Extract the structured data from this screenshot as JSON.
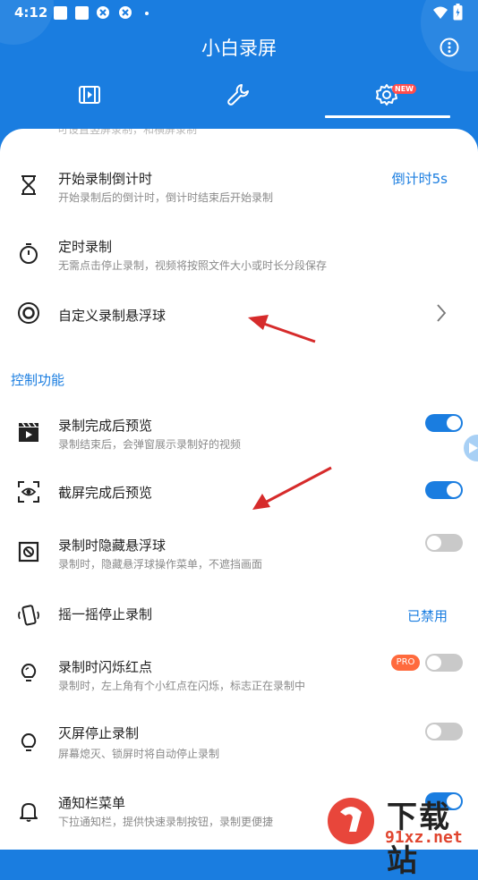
{
  "status_bar": {
    "time": "4:12"
  },
  "app_bar": {
    "title": "小白录屏"
  },
  "tabs": [
    {
      "icon": "video-list-icon",
      "selected": false
    },
    {
      "icon": "wrench-icon",
      "selected": false
    },
    {
      "icon": "settings-gear-icon",
      "selected": true,
      "badge": "NEW"
    }
  ],
  "faded_text": "可设置竖屏录制，和横屏录制",
  "items": [
    {
      "title": "开始录制倒计时",
      "subtitle": "开始录制后的倒计时，倒计时结束后开始录制",
      "value": "倒计时5s",
      "icon": "hourglass-icon"
    },
    {
      "title": "定时录制",
      "subtitle": "无需点击停止录制，视频将按照文件大小或时长分段保存",
      "icon": "stopwatch-icon"
    },
    {
      "title": "自定义录制悬浮球",
      "icon": "target-ring-icon"
    }
  ],
  "section": {
    "title": "控制功能"
  },
  "controls": [
    {
      "title": "录制完成后预览",
      "subtitle": "录制结束后，会弹窗展示录制好的视频",
      "toggle": true,
      "icon": "clapperboard-icon"
    },
    {
      "title": "截屏完成后预览",
      "toggle": true,
      "icon": "screenshot-eye-icon"
    },
    {
      "title": "录制时隐藏悬浮球",
      "subtitle": "录制时，隐藏悬浮球操作菜单，不遮挡画面",
      "toggle": false,
      "icon": "hide-ball-icon"
    },
    {
      "title": "摇一摇停止录制",
      "value": "已禁用",
      "icon": "shake-phone-icon"
    },
    {
      "title": "录制时闪烁红点",
      "subtitle": "录制时，左上角有个小红点在闪烁，标志正在录制中",
      "toggle": false,
      "badge": "PRO",
      "icon": "lightbulb-icon"
    },
    {
      "title": "灭屏停止录制",
      "subtitle": "屏幕熄灭、锁屏时将自动停止录制",
      "toggle": false,
      "icon": "bulb-off-icon"
    },
    {
      "title": "通知栏菜单",
      "subtitle": "下拉通知栏，提供快速录制按钮，录制更便捷",
      "toggle": true,
      "icon": "bell-icon"
    }
  ],
  "watermark": {
    "text": "下载站",
    "url": "91xz.net"
  },
  "colors": {
    "primary": "#1a7de0",
    "annotation_arrow": "#d62b2b",
    "pro_badge": "#ff6a3d"
  }
}
